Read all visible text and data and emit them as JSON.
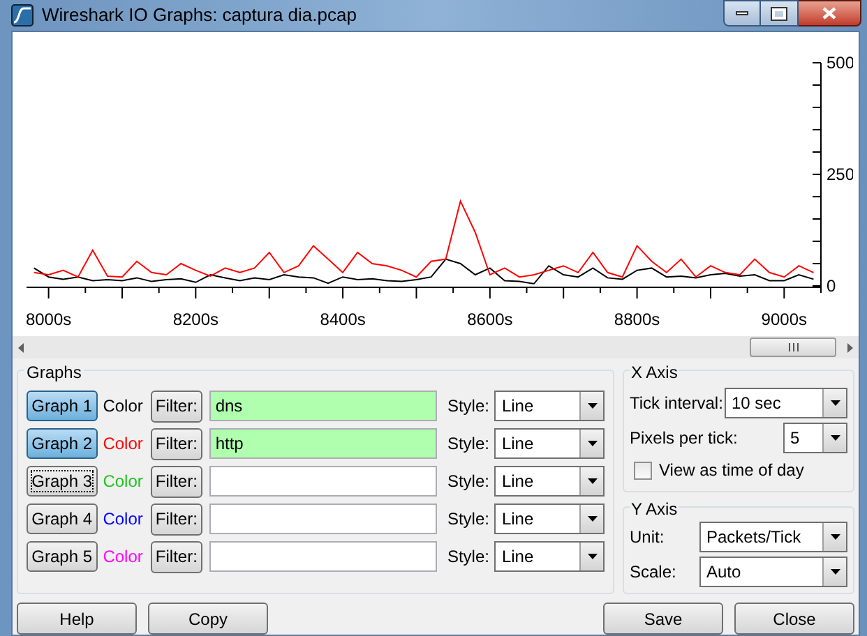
{
  "window": {
    "title": "Wireshark IO Graphs: captura dia.pcap"
  },
  "plot": {
    "chart_data": {
      "type": "line",
      "x": [
        7980,
        8000,
        8020,
        8040,
        8060,
        8080,
        8100,
        8120,
        8140,
        8160,
        8180,
        8200,
        8220,
        8240,
        8260,
        8280,
        8300,
        8320,
        8340,
        8360,
        8380,
        8400,
        8420,
        8440,
        8460,
        8480,
        8500,
        8520,
        8540,
        8560,
        8580,
        8600,
        8620,
        8640,
        8660,
        8680,
        8700,
        8720,
        8740,
        8760,
        8780,
        8800,
        8820,
        8840,
        8860,
        8880,
        8900,
        8920,
        8940,
        8960,
        8980,
        9000,
        9020,
        9040
      ],
      "series": [
        {
          "color": "#000000",
          "values": [
            40,
            20,
            15,
            20,
            12,
            14,
            12,
            18,
            10,
            14,
            16,
            8,
            25,
            18,
            12,
            18,
            14,
            25,
            20,
            18,
            6,
            20,
            14,
            16,
            12,
            10,
            14,
            20,
            60,
            50,
            25,
            40,
            12,
            10,
            5,
            45,
            25,
            20,
            40,
            18,
            15,
            35,
            40,
            20,
            22,
            18,
            25,
            28,
            22,
            25,
            12,
            12,
            25,
            15
          ]
        },
        {
          "color": "#ff0000",
          "values": [
            30,
            25,
            35,
            20,
            80,
            22,
            20,
            55,
            30,
            25,
            50,
            35,
            22,
            40,
            30,
            40,
            75,
            30,
            45,
            90,
            60,
            30,
            75,
            50,
            45,
            35,
            20,
            55,
            60,
            190,
            120,
            25,
            40,
            20,
            25,
            35,
            45,
            30,
            75,
            30,
            20,
            90,
            55,
            30,
            60,
            20,
            45,
            30,
            25,
            60,
            30,
            20,
            45,
            30
          ]
        }
      ],
      "xlim": [
        7970,
        9050
      ],
      "ylim": [
        0,
        500
      ],
      "xticks": [
        {
          "value": 8000,
          "label": "8000s"
        },
        {
          "value": 8200,
          "label": "8200s"
        },
        {
          "value": 8400,
          "label": "8400s"
        },
        {
          "value": 8600,
          "label": "8600s"
        },
        {
          "value": 8800,
          "label": "8800s"
        },
        {
          "value": 9000,
          "label": "9000s"
        }
      ],
      "yticks": [
        0,
        250,
        500
      ]
    }
  },
  "graphs": {
    "title": "Graphs",
    "rows": [
      {
        "button": "Graph 1",
        "selected": true,
        "focused": false,
        "color_label": "Color",
        "color": "#000000",
        "filter_button": "Filter:",
        "filter": "dns",
        "style_label": "Style:",
        "style": "Line"
      },
      {
        "button": "Graph 2",
        "selected": true,
        "focused": false,
        "color_label": "Color",
        "color": "#ff0000",
        "filter_button": "Filter:",
        "filter": "http",
        "style_label": "Style:",
        "style": "Line"
      },
      {
        "button": "Graph 3",
        "selected": false,
        "focused": true,
        "color_label": "Color",
        "color": "#1fc41f",
        "filter_button": "Filter:",
        "style_label": "Style:",
        "style": "Line"
      },
      {
        "button": "Graph 4",
        "selected": false,
        "focused": false,
        "color_label": "Color",
        "color": "#0000ff",
        "filter_button": "Filter:",
        "style_label": "Style:",
        "style": "Line"
      },
      {
        "button": "Graph 5",
        "selected": false,
        "focused": false,
        "color_label": "Color",
        "color": "#ff00ff",
        "filter_button": "Filter:",
        "style_label": "Style:",
        "style": "Line"
      }
    ]
  },
  "x_axis": {
    "title": "X Axis",
    "tick_interval_label": "Tick interval:",
    "tick_interval": "10 sec",
    "pixels_per_tick_label": "Pixels per tick:",
    "pixels_per_tick": "5",
    "time_of_day": {
      "label": "View as time of day",
      "checked": false
    }
  },
  "y_axis": {
    "title": "Y Axis",
    "unit_label": "Unit:",
    "unit": "Packets/Tick",
    "scale_label": "Scale:",
    "scale": "Auto"
  },
  "buttons": {
    "left": [
      "Help",
      "Copy"
    ],
    "right": [
      "Save",
      "Close"
    ]
  }
}
